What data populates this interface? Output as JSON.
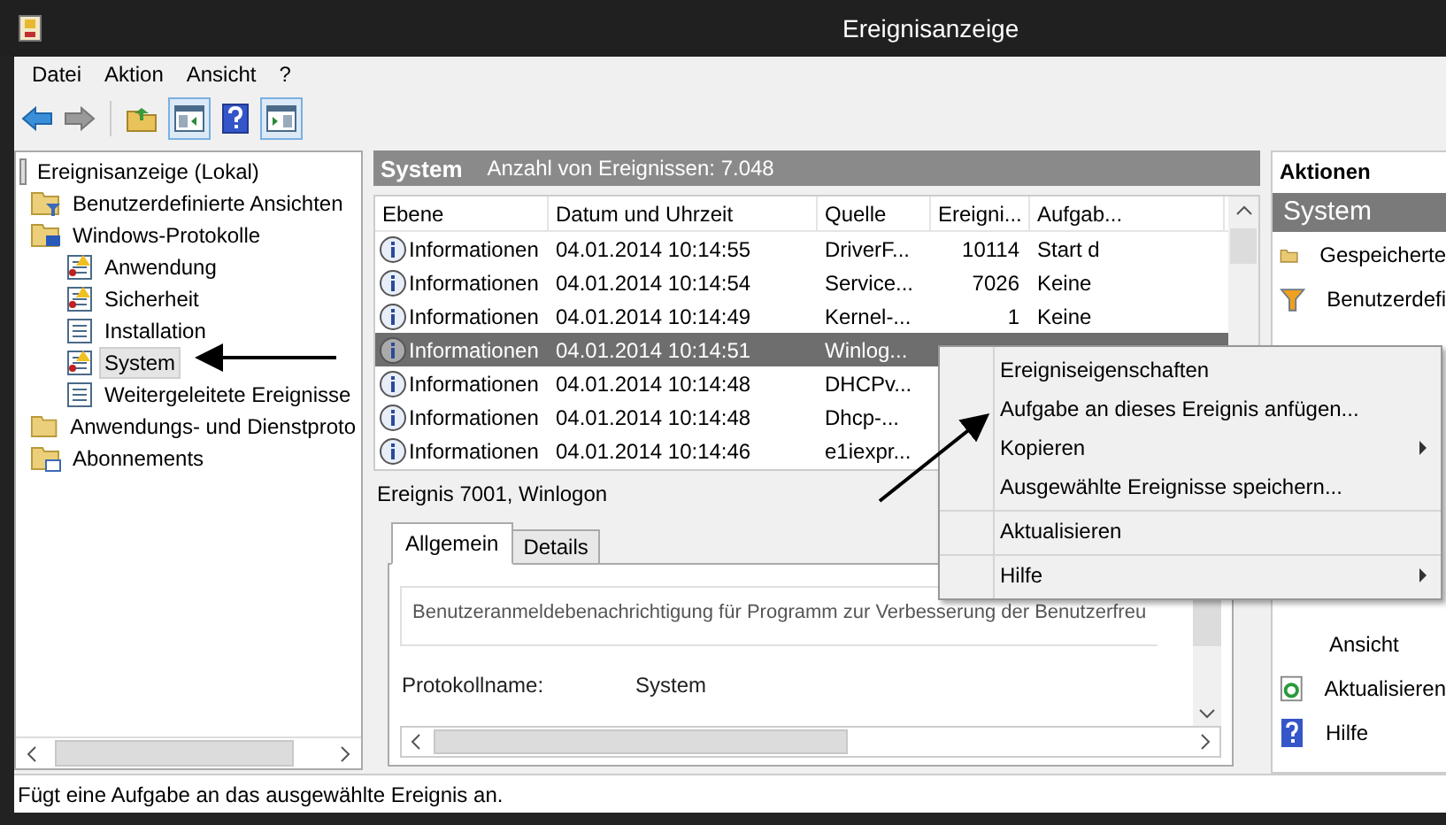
{
  "window": {
    "title": "Ereignisanzeige"
  },
  "menu": [
    "Datei",
    "Aktion",
    "Ansicht",
    "?"
  ],
  "tree": {
    "label": "Ereignisanzeige (Lokal)",
    "kind": "root",
    "selected": false,
    "children": [
      {
        "label": "Benutzerdefinierte Ansichten",
        "kind": "filter-folder",
        "selected": false
      },
      {
        "label": "Windows-Protokolle",
        "kind": "folder",
        "selected": false,
        "children": [
          {
            "label": "Anwendung",
            "kind": "log",
            "selected": false
          },
          {
            "label": "Sicherheit",
            "kind": "log",
            "selected": false
          },
          {
            "label": "Installation",
            "kind": "plain-log",
            "selected": false
          },
          {
            "label": "System",
            "kind": "log",
            "selected": true
          },
          {
            "label": "Weitergeleitete Ereignisse",
            "kind": "plain-log",
            "selected": false
          }
        ]
      },
      {
        "label": "Anwendungs- und Dienstproto",
        "kind": "folder",
        "selected": false
      },
      {
        "label": "Abonnements",
        "kind": "subscription",
        "selected": false
      }
    ]
  },
  "log_header": {
    "name": "System",
    "count": "Anzahl von Ereignissen: 7.048"
  },
  "table": {
    "columns": [
      "Ebene",
      "Datum und Uhrzeit",
      "Quelle",
      "Ereigni...",
      "Aufgab..."
    ],
    "rows": [
      {
        "level": "Informationen",
        "date": "04.01.2014 10:14:55",
        "source": "DriverF...",
        "id": "10114",
        "task": "Start d",
        "selected": false
      },
      {
        "level": "Informationen",
        "date": "04.01.2014 10:14:54",
        "source": "Service...",
        "id": "7026",
        "task": "Keine",
        "selected": false
      },
      {
        "level": "Informationen",
        "date": "04.01.2014 10:14:49",
        "source": "Kernel-...",
        "id": "1",
        "task": "Keine",
        "selected": false
      },
      {
        "level": "Informationen",
        "date": "04.01.2014 10:14:51",
        "source": "Winlog...",
        "selected": true
      },
      {
        "level": "Informationen",
        "date": "04.01.2014 10:14:48",
        "source": "DHCPv...",
        "selected": false
      },
      {
        "level": "Informationen",
        "date": "04.01.2014 10:14:48",
        "source": "Dhcp-...",
        "selected": false
      },
      {
        "level": "Informationen",
        "date": "04.01.2014 10:14:46",
        "source": "e1iexpr...",
        "selected": false
      }
    ]
  },
  "detail": {
    "title": "Ereignis 7001, Winlogon",
    "tabs": [
      {
        "label": "Allgemein",
        "selected": true
      },
      {
        "label": "Details",
        "selected": false
      }
    ],
    "message": "Benutzeranmeldebenachrichtigung für Programm zur Verbesserung der Benutzerfreu",
    "field_label": "Protokollname:",
    "field_value": "System"
  },
  "actions": {
    "title": "Aktionen",
    "section": "System",
    "items_above": [
      {
        "label": "Gespeicherte",
        "kind": "folder"
      },
      {
        "label": "Benutzerdefi",
        "kind": "filter"
      }
    ],
    "items_below": [
      {
        "label": "Ansicht",
        "kind": "none"
      },
      {
        "label": "Aktualisieren",
        "kind": "refresh"
      },
      {
        "label": "Hilfe",
        "kind": "help"
      }
    ]
  },
  "context_menu": [
    {
      "label": "Ereigniseigenschaften",
      "submenu": false,
      "separator_before": false
    },
    {
      "label": "Aufgabe an dieses Ereignis anfügen...",
      "submenu": false,
      "separator_before": false
    },
    {
      "label": "Kopieren",
      "submenu": true,
      "separator_before": false
    },
    {
      "label": "Ausgewählte Ereignisse speichern...",
      "submenu": false,
      "separator_before": false
    },
    {
      "label": "Aktualisieren",
      "submenu": false,
      "separator_before": true
    },
    {
      "label": "Hilfe",
      "submenu": true,
      "separator_before": true
    }
  ],
  "status_bar": "Fügt eine Aufgabe an das ausgewählte Ereignis an."
}
